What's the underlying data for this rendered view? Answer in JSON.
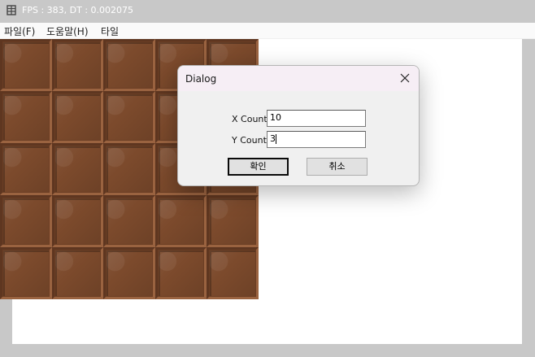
{
  "window": {
    "title": "FPS : 383, DT : 0.002075"
  },
  "menubar": {
    "items": [
      {
        "label": "파일(F)"
      },
      {
        "label": "도움말(H)"
      },
      {
        "label": "타일"
      }
    ]
  },
  "tilemap": {
    "columns": 5,
    "rows": 5,
    "tile_color": "#7c4a2c"
  },
  "dialog": {
    "title": "Dialog",
    "x_count": {
      "label": "X Count",
      "value": "10"
    },
    "y_count": {
      "label": "Y Count",
      "value": "3"
    },
    "ok_label": "확인",
    "cancel_label": "취소"
  }
}
